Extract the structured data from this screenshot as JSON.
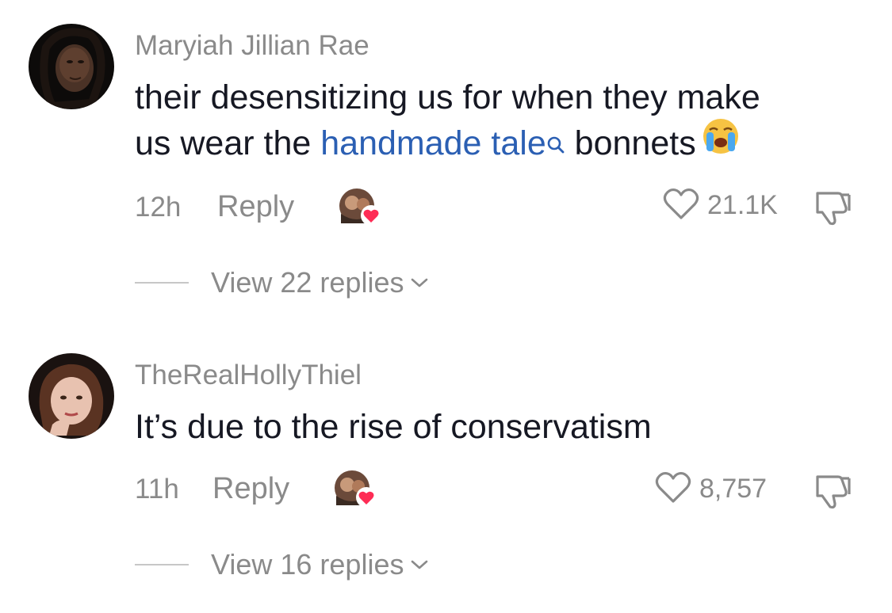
{
  "comments": [
    {
      "username": "Maryiah Jillian Rae",
      "text_line1": "their desensitizing us for when they make",
      "text_line2_before": "us wear the ",
      "text_line2_link": "handmade tale",
      "text_line2_after": " bonnets",
      "emoji": "loudly-crying-face-icon",
      "timestamp": "12h",
      "reply_label": "Reply",
      "like_count": "21.1K",
      "view_replies_label": "View 22 replies"
    },
    {
      "username": "TheRealHollyThiel",
      "text_line1": "It’s due to the rise of conservatism",
      "timestamp": "11h",
      "reply_label": "Reply",
      "like_count": "8,757",
      "view_replies_label": "View 16 replies"
    }
  ],
  "colors": {
    "text": "#161823",
    "muted": "#8a8a8a",
    "link": "#2b5fb3",
    "creator_heart": "#fe2c55"
  }
}
